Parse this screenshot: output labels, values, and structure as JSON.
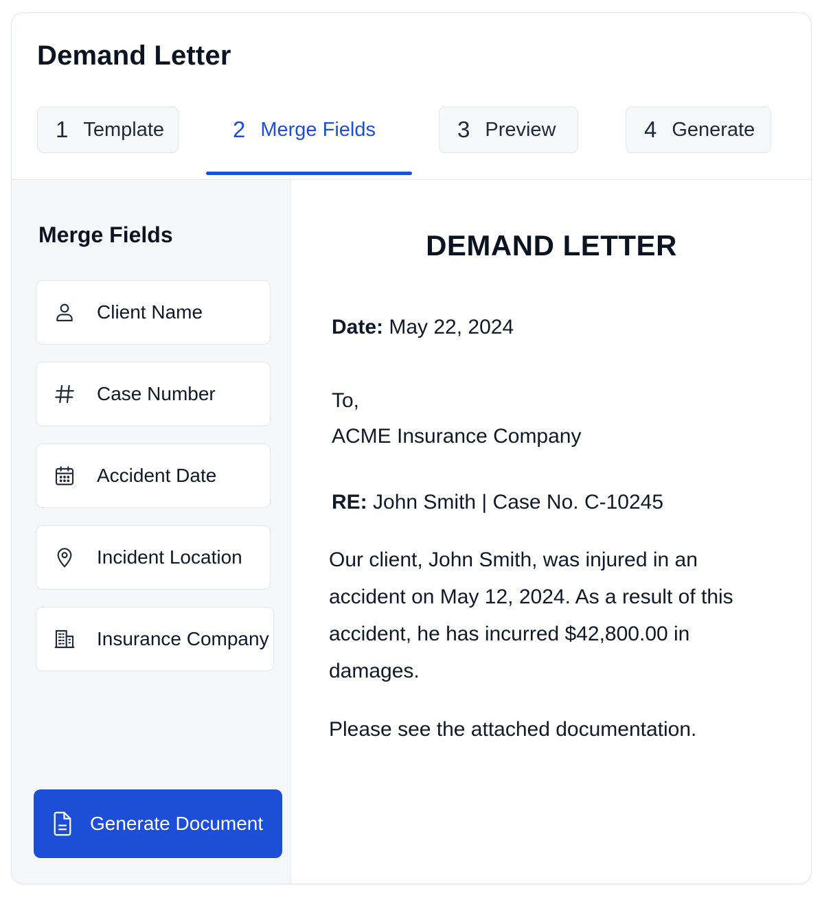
{
  "app": {
    "title": "Demand Letter"
  },
  "steps": [
    {
      "num": "1",
      "label": "Template"
    },
    {
      "num": "2",
      "label": "Merge Fields"
    },
    {
      "num": "3",
      "label": "Preview"
    },
    {
      "num": "4",
      "label": "Generate"
    }
  ],
  "active_step": "Merge Fields",
  "sidebar": {
    "title": "Merge Fields",
    "fields": [
      {
        "label": "Client Name",
        "icon": "user-icon"
      },
      {
        "label": "Case Number",
        "icon": "hash-icon"
      },
      {
        "label": "Accident Date",
        "icon": "calendar-icon"
      },
      {
        "label": "Incident Location",
        "icon": "location-pin-icon"
      },
      {
        "label": "Insurance Company",
        "icon": "building-icon"
      }
    ],
    "generate_button": {
      "label": "Generate Document",
      "icon": "document-icon"
    }
  },
  "document": {
    "title": "DEMAND LETTER",
    "date_label": "Date:",
    "date_value": "May 22, 2024",
    "to_label": "To,",
    "recipient": "ACME Insurance Company",
    "re_label": "RE:",
    "re_value": "John Smith | Case No. C-10245",
    "body": "Our client, John Smith, was injured in an accident on May 12, 2024. As a result of this accident, he has incurred $42,800.00 in damages.",
    "footer": "Please see the attached documentation."
  },
  "colors": {
    "accent": "#1d4ed8",
    "sidebar_bg": "#f6f7f9",
    "border": "#e3e6eb"
  }
}
